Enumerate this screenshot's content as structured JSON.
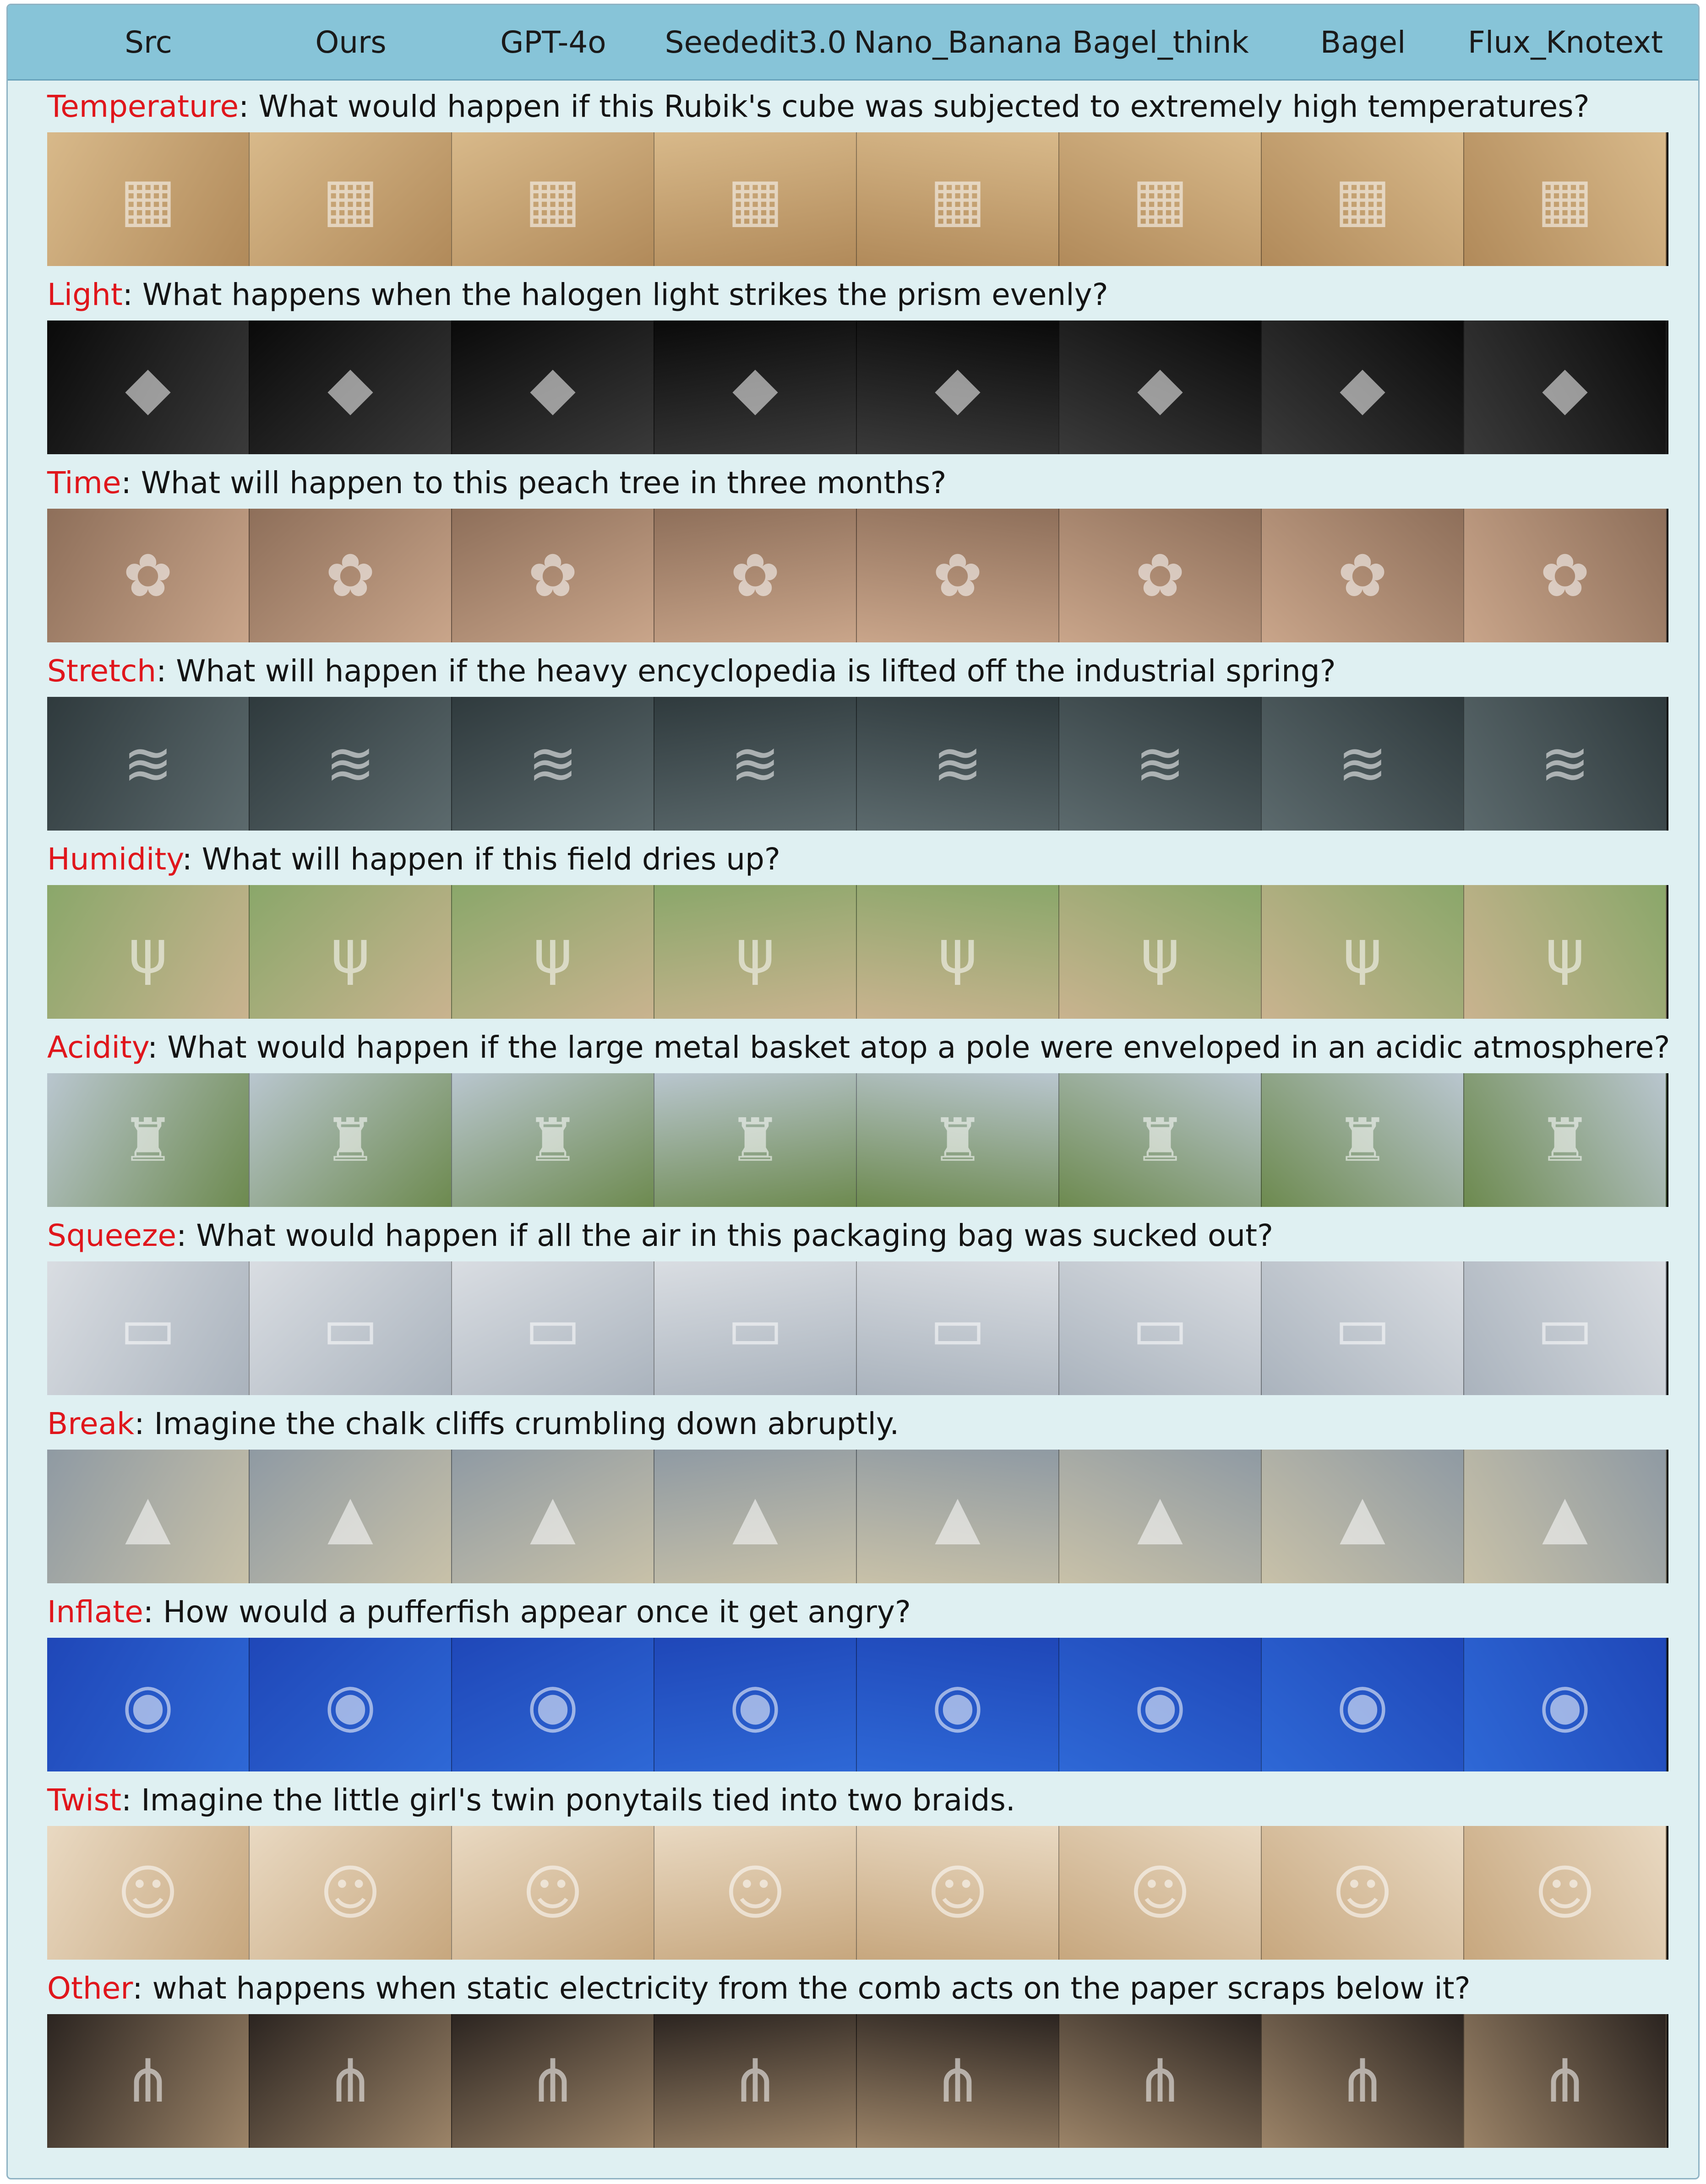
{
  "columns": [
    "Src",
    "Ours",
    "GPT-4o",
    "Seededit3.0",
    "Nano_Banana",
    "Bagel_think",
    "Bagel",
    "Flux_Knotext"
  ],
  "rows": [
    {
      "category": "Temperature",
      "question": ": What would happen if this Rubik's cube was subjected to extremely high temperatures?",
      "icon": "cube-icon"
    },
    {
      "category": "Light",
      "question": ": What happens when the halogen light strikes the prism evenly?",
      "icon": "prism-icon"
    },
    {
      "category": "Time",
      "question": ": What will happen to this peach tree in three months?",
      "icon": "flower-icon"
    },
    {
      "category": "Stretch",
      "question": ": What will happen if the heavy encyclopedia is lifted off the industrial spring?",
      "icon": "spring-icon"
    },
    {
      "category": "Humidity",
      "question": ": What will happen if this field dries up?",
      "icon": "grass-icon"
    },
    {
      "category": "Acidity",
      "question": ": What would happen if the large metal basket atop a pole were enveloped in an acidic atmosphere?",
      "icon": "basket-icon"
    },
    {
      "category": "Squeeze",
      "question": ": What would happen if all the air in this packaging bag was sucked out?",
      "icon": "pillow-icon"
    },
    {
      "category": "Break",
      "question": ": Imagine the chalk cliffs crumbling down abruptly.",
      "icon": "cliff-icon"
    },
    {
      "category": "Inflate",
      "question": ": How would a pufferfish appear once it get angry?",
      "icon": "fish-icon"
    },
    {
      "category": "Twist",
      "question": ": Imagine the little girl's twin ponytails tied into two braids.",
      "icon": "girl-icon"
    },
    {
      "category": "Other",
      "question": ": what happens when static electricity from the comb acts on the paper scraps below it?",
      "icon": "comb-icon"
    }
  ]
}
